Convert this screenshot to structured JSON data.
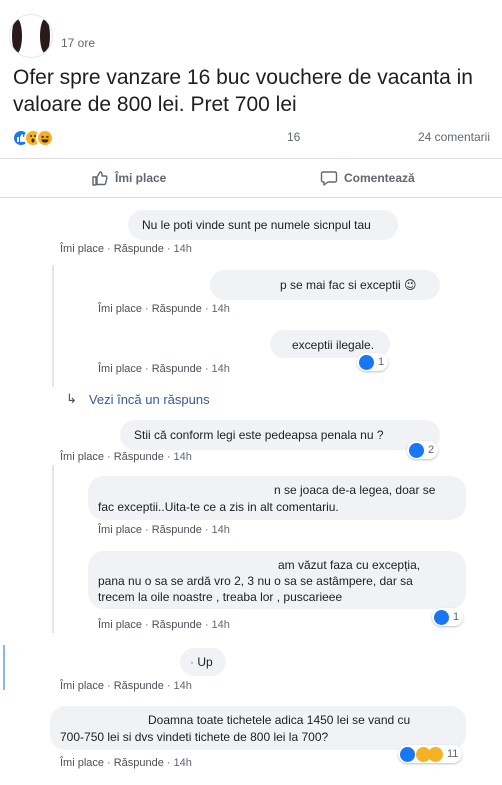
{
  "post": {
    "time": "17 ore",
    "text": "Ofer spre vanzare 16 buc vouchere de vacanta in valoare de 800 lei. Pret 700 lei",
    "reactions_count": "16",
    "comments_count": "24 comentarii",
    "like_label": "Îmi place",
    "comment_label": "Comentează"
  },
  "comments": [
    {
      "text": "Nu le poti vinde sunt pe numele sicnpul tau",
      "like": "Îmi place",
      "reply": "Răspunde",
      "time": "14h"
    },
    {
      "text": "p se mai fac si exceptii 😉",
      "like": "Îmi place",
      "reply": "Răspunde",
      "time": "14h"
    },
    {
      "text": "exceptii ilegale.",
      "like": "Îmi place",
      "reply": "Răspunde",
      "time": "14h",
      "reactions": "1"
    },
    {
      "text": "Stii că conform legi este pedeapsa penala nu ?",
      "like": "Îmi place",
      "reply": "Răspunde",
      "time": "14h",
      "reactions": "2"
    },
    {
      "text_line1": "n se joaca de-a legea, doar se",
      "text_line2": "fac exceptii..Uita-te ce a zis in alt comentariu.",
      "like": "Îmi place",
      "reply": "Răspunde",
      "time": "14h"
    },
    {
      "text_line1": "am văzut faza cu excepția,",
      "text_line2": "pana nu o sa se ardă vro 2, 3 nu o sa se astâmpere, dar sa",
      "text_line3": "trecem la oile noastre , treaba lor , puscarieee",
      "like": "Îmi place",
      "reply": "Răspunde",
      "time": "14h",
      "reactions": "1"
    },
    {
      "text": "Up",
      "like": "Îmi place",
      "reply": "Răspunde",
      "time": "14h"
    },
    {
      "text_line1": "Doamna toate tichetele adica 1450 lei se vand cu",
      "text_line2": "700-750 lei si dvs vindeti tichete de 800 lei la 700?",
      "like": "Îmi place",
      "reply": "Răspunde",
      "time": "14h",
      "reactions": "11"
    }
  ],
  "more_replies": "Vezi încă un răspuns",
  "icons": {
    "like": "thumbs-up-icon",
    "comment": "comment-bubble-icon",
    "reply_arrow": "reply-arrow-icon"
  },
  "colors": {
    "like_blue": "#1877f2",
    "link": "#385898",
    "bubble": "#f0f2f5",
    "emoji": "#f7b125"
  }
}
